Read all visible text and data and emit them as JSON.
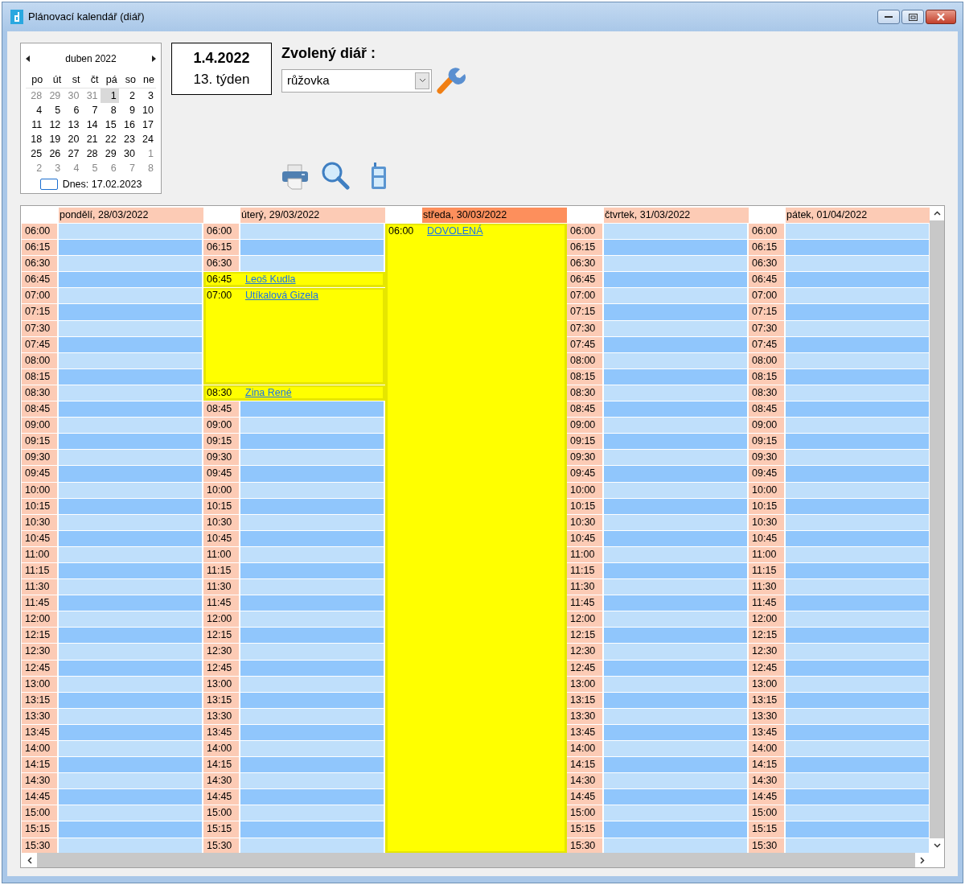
{
  "window": {
    "title": "Plánovací kalendář (diář)"
  },
  "mini_calendar": {
    "month": "duben 2022",
    "weekdays": [
      "po",
      "út",
      "st",
      "čt",
      "pá",
      "so",
      "ne"
    ],
    "weeks": [
      [
        {
          "day": "28",
          "muted": true,
          "selected": false
        },
        {
          "day": "29",
          "muted": true,
          "selected": false
        },
        {
          "day": "30",
          "muted": true,
          "selected": false
        },
        {
          "day": "31",
          "muted": true,
          "selected": false
        },
        {
          "day": "1",
          "muted": false,
          "selected": true
        },
        {
          "day": "2",
          "muted": false,
          "selected": false
        },
        {
          "day": "3",
          "muted": false,
          "selected": false
        }
      ],
      [
        {
          "day": "4",
          "muted": false,
          "selected": false
        },
        {
          "day": "5",
          "muted": false,
          "selected": false
        },
        {
          "day": "6",
          "muted": false,
          "selected": false
        },
        {
          "day": "7",
          "muted": false,
          "selected": false
        },
        {
          "day": "8",
          "muted": false,
          "selected": false
        },
        {
          "day": "9",
          "muted": false,
          "selected": false
        },
        {
          "day": "10",
          "muted": false,
          "selected": false
        }
      ],
      [
        {
          "day": "11",
          "muted": false,
          "selected": false
        },
        {
          "day": "12",
          "muted": false,
          "selected": false
        },
        {
          "day": "13",
          "muted": false,
          "selected": false
        },
        {
          "day": "14",
          "muted": false,
          "selected": false
        },
        {
          "day": "15",
          "muted": false,
          "selected": false
        },
        {
          "day": "16",
          "muted": false,
          "selected": false
        },
        {
          "day": "17",
          "muted": false,
          "selected": false
        }
      ],
      [
        {
          "day": "18",
          "muted": false,
          "selected": false
        },
        {
          "day": "19",
          "muted": false,
          "selected": false
        },
        {
          "day": "20",
          "muted": false,
          "selected": false
        },
        {
          "day": "21",
          "muted": false,
          "selected": false
        },
        {
          "day": "22",
          "muted": false,
          "selected": false
        },
        {
          "day": "23",
          "muted": false,
          "selected": false
        },
        {
          "day": "24",
          "muted": false,
          "selected": false
        }
      ],
      [
        {
          "day": "25",
          "muted": false,
          "selected": false
        },
        {
          "day": "26",
          "muted": false,
          "selected": false
        },
        {
          "day": "27",
          "muted": false,
          "selected": false
        },
        {
          "day": "28",
          "muted": false,
          "selected": false
        },
        {
          "day": "29",
          "muted": false,
          "selected": false
        },
        {
          "day": "30",
          "muted": false,
          "selected": false
        },
        {
          "day": "1",
          "muted": true,
          "selected": false
        }
      ],
      [
        {
          "day": "2",
          "muted": true,
          "selected": false
        },
        {
          "day": "3",
          "muted": true,
          "selected": false
        },
        {
          "day": "4",
          "muted": true,
          "selected": false
        },
        {
          "day": "5",
          "muted": true,
          "selected": false
        },
        {
          "day": "6",
          "muted": true,
          "selected": false
        },
        {
          "day": "7",
          "muted": true,
          "selected": false
        },
        {
          "day": "8",
          "muted": true,
          "selected": false
        }
      ]
    ],
    "today": "Dnes: 17.02.2023"
  },
  "date_box": {
    "date": "1.4.2022",
    "week": "13. týden"
  },
  "diary": {
    "label": "Zvolený diář :",
    "value": "růžovka"
  },
  "days": [
    {
      "label": "pondělí, 28/03/2022",
      "selected": false,
      "rows": [
        {
          "kind": "slot",
          "time": "06:00"
        },
        {
          "kind": "slot",
          "time": "06:15"
        },
        {
          "kind": "slot",
          "time": "06:30"
        },
        {
          "kind": "slot",
          "time": "06:45"
        },
        {
          "kind": "slot",
          "time": "07:00"
        },
        {
          "kind": "slot",
          "time": "07:15"
        },
        {
          "kind": "slot",
          "time": "07:30"
        },
        {
          "kind": "slot",
          "time": "07:45"
        },
        {
          "kind": "slot",
          "time": "08:00"
        },
        {
          "kind": "slot",
          "time": "08:15"
        },
        {
          "kind": "slot",
          "time": "08:30"
        },
        {
          "kind": "slot",
          "time": "08:45"
        },
        {
          "kind": "slot",
          "time": "09:00"
        },
        {
          "kind": "slot",
          "time": "09:15"
        },
        {
          "kind": "slot",
          "time": "09:30"
        },
        {
          "kind": "slot",
          "time": "09:45"
        },
        {
          "kind": "slot",
          "time": "10:00"
        },
        {
          "kind": "slot",
          "time": "10:15"
        },
        {
          "kind": "slot",
          "time": "10:30"
        },
        {
          "kind": "slot",
          "time": "10:45"
        },
        {
          "kind": "slot",
          "time": "11:00"
        },
        {
          "kind": "slot",
          "time": "11:15"
        },
        {
          "kind": "slot",
          "time": "11:30"
        },
        {
          "kind": "slot",
          "time": "11:45"
        },
        {
          "kind": "slot",
          "time": "12:00"
        },
        {
          "kind": "slot",
          "time": "12:15"
        },
        {
          "kind": "slot",
          "time": "12:30"
        },
        {
          "kind": "slot",
          "time": "12:45"
        },
        {
          "kind": "slot",
          "time": "13:00"
        },
        {
          "kind": "slot",
          "time": "13:15"
        },
        {
          "kind": "slot",
          "time": "13:30"
        },
        {
          "kind": "slot",
          "time": "13:45"
        },
        {
          "kind": "slot",
          "time": "14:00"
        },
        {
          "kind": "slot",
          "time": "14:15"
        },
        {
          "kind": "slot",
          "time": "14:30"
        },
        {
          "kind": "slot",
          "time": "14:45"
        },
        {
          "kind": "slot",
          "time": "15:00"
        },
        {
          "kind": "slot",
          "time": "15:15"
        },
        {
          "kind": "slot",
          "time": "15:30"
        }
      ]
    },
    {
      "label": "úterý, 29/03/2022",
      "selected": false,
      "rows": [
        {
          "kind": "slot",
          "time": "06:00"
        },
        {
          "kind": "slot",
          "time": "06:15"
        },
        {
          "kind": "slot",
          "time": "06:30"
        },
        {
          "kind": "event",
          "time": "06:45",
          "title": "Leoš Kudla"
        },
        {
          "kind": "event",
          "time": "07:00",
          "title": "Utíkalová Gizela"
        },
        {
          "kind": "event",
          "time": "08:30",
          "title": "Zina René"
        },
        {
          "kind": "slot",
          "time": "08:45"
        },
        {
          "kind": "slot",
          "time": "09:00"
        },
        {
          "kind": "slot",
          "time": "09:15"
        },
        {
          "kind": "slot",
          "time": "09:30"
        },
        {
          "kind": "slot",
          "time": "09:45"
        },
        {
          "kind": "slot",
          "time": "10:00"
        },
        {
          "kind": "slot",
          "time": "10:15"
        },
        {
          "kind": "slot",
          "time": "10:30"
        },
        {
          "kind": "slot",
          "time": "10:45"
        },
        {
          "kind": "slot",
          "time": "11:00"
        },
        {
          "kind": "slot",
          "time": "11:15"
        },
        {
          "kind": "slot",
          "time": "11:30"
        },
        {
          "kind": "slot",
          "time": "11:45"
        },
        {
          "kind": "slot",
          "time": "12:00"
        },
        {
          "kind": "slot",
          "time": "12:15"
        },
        {
          "kind": "slot",
          "time": "12:30"
        },
        {
          "kind": "slot",
          "time": "12:45"
        },
        {
          "kind": "slot",
          "time": "13:00"
        },
        {
          "kind": "slot",
          "time": "13:15"
        },
        {
          "kind": "slot",
          "time": "13:30"
        },
        {
          "kind": "slot",
          "time": "13:45"
        },
        {
          "kind": "slot",
          "time": "14:00"
        },
        {
          "kind": "slot",
          "time": "14:15"
        },
        {
          "kind": "slot",
          "time": "14:30"
        },
        {
          "kind": "slot",
          "time": "14:45"
        },
        {
          "kind": "slot",
          "time": "15:00"
        },
        {
          "kind": "slot",
          "time": "15:15"
        },
        {
          "kind": "slot",
          "time": "15:30"
        }
      ]
    },
    {
      "label": "středa, 30/03/2022",
      "selected": true,
      "rows": [
        {
          "kind": "event",
          "time": "06:00",
          "title": "DOVOLENÁ"
        }
      ]
    },
    {
      "label": "čtvrtek, 31/03/2022",
      "selected": false,
      "rows": [
        {
          "kind": "slot",
          "time": "06:00"
        },
        {
          "kind": "slot",
          "time": "06:15"
        },
        {
          "kind": "slot",
          "time": "06:30"
        },
        {
          "kind": "slot",
          "time": "06:45"
        },
        {
          "kind": "slot",
          "time": "07:00"
        },
        {
          "kind": "slot",
          "time": "07:15"
        },
        {
          "kind": "slot",
          "time": "07:30"
        },
        {
          "kind": "slot",
          "time": "07:45"
        },
        {
          "kind": "slot",
          "time": "08:00"
        },
        {
          "kind": "slot",
          "time": "08:15"
        },
        {
          "kind": "slot",
          "time": "08:30"
        },
        {
          "kind": "slot",
          "time": "08:45"
        },
        {
          "kind": "slot",
          "time": "09:00"
        },
        {
          "kind": "slot",
          "time": "09:15"
        },
        {
          "kind": "slot",
          "time": "09:30"
        },
        {
          "kind": "slot",
          "time": "09:45"
        },
        {
          "kind": "slot",
          "time": "10:00"
        },
        {
          "kind": "slot",
          "time": "10:15"
        },
        {
          "kind": "slot",
          "time": "10:30"
        },
        {
          "kind": "slot",
          "time": "10:45"
        },
        {
          "kind": "slot",
          "time": "11:00"
        },
        {
          "kind": "slot",
          "time": "11:15"
        },
        {
          "kind": "slot",
          "time": "11:30"
        },
        {
          "kind": "slot",
          "time": "11:45"
        },
        {
          "kind": "slot",
          "time": "12:00"
        },
        {
          "kind": "slot",
          "time": "12:15"
        },
        {
          "kind": "slot",
          "time": "12:30"
        },
        {
          "kind": "slot",
          "time": "12:45"
        },
        {
          "kind": "slot",
          "time": "13:00"
        },
        {
          "kind": "slot",
          "time": "13:15"
        },
        {
          "kind": "slot",
          "time": "13:30"
        },
        {
          "kind": "slot",
          "time": "13:45"
        },
        {
          "kind": "slot",
          "time": "14:00"
        },
        {
          "kind": "slot",
          "time": "14:15"
        },
        {
          "kind": "slot",
          "time": "14:30"
        },
        {
          "kind": "slot",
          "time": "14:45"
        },
        {
          "kind": "slot",
          "time": "15:00"
        },
        {
          "kind": "slot",
          "time": "15:15"
        },
        {
          "kind": "slot",
          "time": "15:30"
        }
      ]
    },
    {
      "label": "pátek, 01/04/2022",
      "selected": false,
      "rows": [
        {
          "kind": "slot",
          "time": "06:00"
        },
        {
          "kind": "slot",
          "time": "06:15"
        },
        {
          "kind": "slot",
          "time": "06:30"
        },
        {
          "kind": "slot",
          "time": "06:45"
        },
        {
          "kind": "slot",
          "time": "07:00"
        },
        {
          "kind": "slot",
          "time": "07:15"
        },
        {
          "kind": "slot",
          "time": "07:30"
        },
        {
          "kind": "slot",
          "time": "07:45"
        },
        {
          "kind": "slot",
          "time": "08:00"
        },
        {
          "kind": "slot",
          "time": "08:15"
        },
        {
          "kind": "slot",
          "time": "08:30"
        },
        {
          "kind": "slot",
          "time": "08:45"
        },
        {
          "kind": "slot",
          "time": "09:00"
        },
        {
          "kind": "slot",
          "time": "09:15"
        },
        {
          "kind": "slot",
          "time": "09:30"
        },
        {
          "kind": "slot",
          "time": "09:45"
        },
        {
          "kind": "slot",
          "time": "10:00"
        },
        {
          "kind": "slot",
          "time": "10:15"
        },
        {
          "kind": "slot",
          "time": "10:30"
        },
        {
          "kind": "slot",
          "time": "10:45"
        },
        {
          "kind": "slot",
          "time": "11:00"
        },
        {
          "kind": "slot",
          "time": "11:15"
        },
        {
          "kind": "slot",
          "time": "11:30"
        },
        {
          "kind": "slot",
          "time": "11:45"
        },
        {
          "kind": "slot",
          "time": "12:00"
        },
        {
          "kind": "slot",
          "time": "12:15"
        },
        {
          "kind": "slot",
          "time": "12:30"
        },
        {
          "kind": "slot",
          "time": "12:45"
        },
        {
          "kind": "slot",
          "time": "13:00"
        },
        {
          "kind": "slot",
          "time": "13:15"
        },
        {
          "kind": "slot",
          "time": "13:30"
        },
        {
          "kind": "slot",
          "time": "13:45"
        },
        {
          "kind": "slot",
          "time": "14:00"
        },
        {
          "kind": "slot",
          "time": "14:15"
        },
        {
          "kind": "slot",
          "time": "14:30"
        },
        {
          "kind": "slot",
          "time": "14:45"
        },
        {
          "kind": "slot",
          "time": "15:00"
        },
        {
          "kind": "slot",
          "time": "15:15"
        },
        {
          "kind": "slot",
          "time": "15:30"
        }
      ]
    }
  ]
}
